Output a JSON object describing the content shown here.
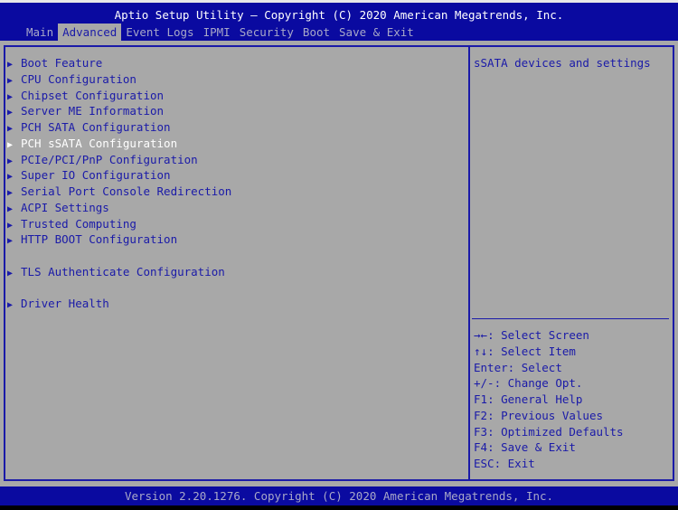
{
  "header": {
    "title": "Aptio Setup Utility – Copyright (C) 2020 American Megatrends, Inc.",
    "tabs": [
      {
        "label": "Main",
        "active": false
      },
      {
        "label": "Advanced",
        "active": true
      },
      {
        "label": "Event Logs",
        "active": false
      },
      {
        "label": "IPMI",
        "active": false
      },
      {
        "label": "Security",
        "active": false
      },
      {
        "label": "Boot",
        "active": false
      },
      {
        "label": "Save & Exit",
        "active": false
      }
    ]
  },
  "menu": {
    "arrow_icon": "right-triangle",
    "items": [
      {
        "label": "Boot Feature"
      },
      {
        "label": "CPU Configuration"
      },
      {
        "label": "Chipset Configuration"
      },
      {
        "label": "Server ME Information"
      },
      {
        "label": "PCH SATA Configuration"
      },
      {
        "label": "PCH sSATA Configuration",
        "selected": true
      },
      {
        "label": "PCIe/PCI/PnP Configuration"
      },
      {
        "label": "Super IO Configuration"
      },
      {
        "label": "Serial Port Console Redirection"
      },
      {
        "label": "ACPI Settings"
      },
      {
        "label": "Trusted Computing"
      },
      {
        "label": "HTTP BOOT Configuration"
      },
      {
        "label": "TLS Authenticate Configuration"
      },
      {
        "label": "Driver Health"
      }
    ]
  },
  "help": {
    "description": "sSATA devices and settings",
    "keys": [
      {
        "key": "→←",
        "action": "Select Screen"
      },
      {
        "key": "↑↓",
        "action": "Select Item"
      },
      {
        "key": "Enter",
        "action": "Select"
      },
      {
        "key": "+/-",
        "action": "Change Opt."
      },
      {
        "key": "F1",
        "action": "General Help"
      },
      {
        "key": "F2",
        "action": "Previous Values"
      },
      {
        "key": "F3",
        "action": "Optimized Defaults"
      },
      {
        "key": "F4",
        "action": "Save & Exit"
      },
      {
        "key": "ESC",
        "action": "Exit"
      }
    ]
  },
  "footer": {
    "text": "Version 2.20.1276. Copyright (C) 2020 American Megatrends, Inc."
  },
  "colors": {
    "header_bg": "#0a0aa0",
    "body_bg": "#a8a8a8",
    "text": "#1a1aa8",
    "selected": "#ffffff"
  }
}
